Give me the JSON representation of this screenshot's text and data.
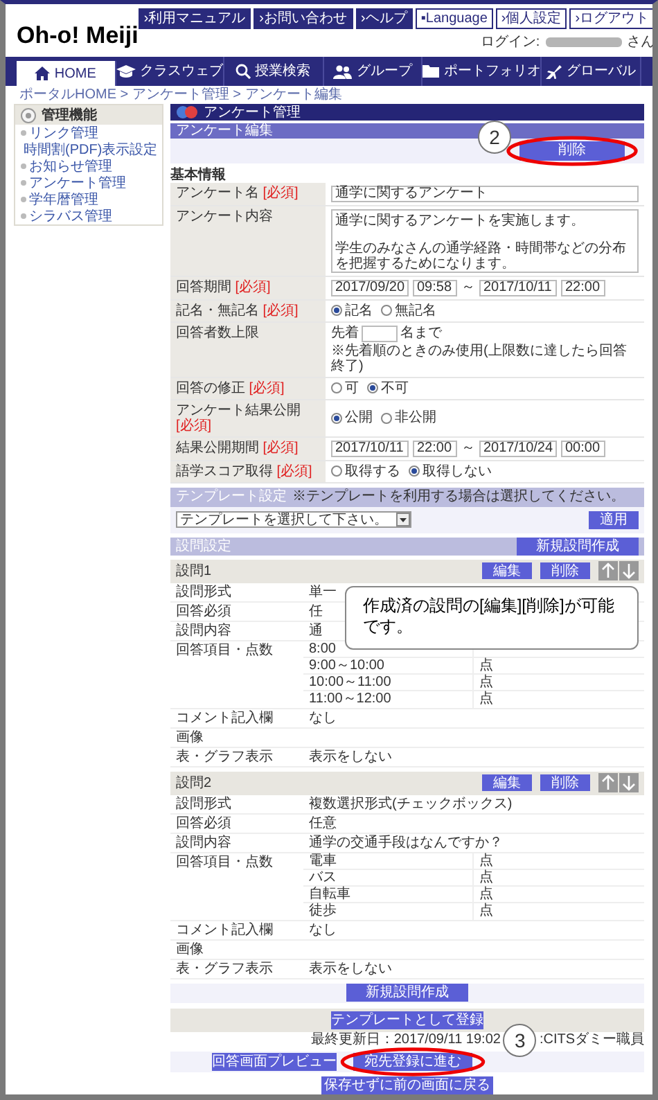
{
  "header": {
    "logo": "Oh-o! Meiji",
    "top_links": [
      {
        "label": "›利用マニュアル",
        "kind": "dark"
      },
      {
        "label": "›お問い合わせ",
        "kind": "dark"
      },
      {
        "label": "›ヘルプ",
        "kind": "dark"
      },
      {
        "label": "▪Language",
        "kind": "light"
      },
      {
        "label": "›個人設定",
        "kind": "light"
      },
      {
        "label": "›ログアウト",
        "kind": "light"
      }
    ],
    "login_label": "ログイン:",
    "login_suffix": "さん"
  },
  "nav": [
    {
      "label": "HOME",
      "selected": true
    },
    {
      "label": "クラスウェブ",
      "selected": false
    },
    {
      "label": "授業検索",
      "selected": false
    },
    {
      "label": "グループ",
      "selected": false
    },
    {
      "label": "ポートフォリオ",
      "selected": false
    },
    {
      "label": "グローバル",
      "selected": false
    }
  ],
  "breadcrumb": "ポータルHOME > アンケート管理 > アンケート編集",
  "sidebar": {
    "title": "管理機能",
    "items": [
      "リンク管理",
      "時間割(PDF)表示設定",
      "お知らせ管理",
      "アンケート管理",
      "学年暦管理",
      "シラバス管理"
    ]
  },
  "page_title": "アンケート管理",
  "section_title": "アンケート編集",
  "delete_button": "削除",
  "basic_info": {
    "heading": "基本情報",
    "rows": [
      {
        "kind": "text",
        "label": "アンケート名",
        "required": "[必須]",
        "value": "通学に関するアンケート"
      },
      {
        "kind": "textarea",
        "label": "アンケート内容",
        "lines": [
          "通学に関するアンケートを実施します。",
          "学生のみなさんの通学経路・時間帯などの分布を把握するためになります。"
        ]
      },
      {
        "kind": "period",
        "label": "回答期間",
        "required": "[必須]",
        "values": [
          "2017/09/20",
          "09:58",
          "2017/10/11",
          "22:00"
        ],
        "separator": "～"
      },
      {
        "kind": "radio",
        "label": "記名・無記名",
        "required": "[必須]",
        "options": [
          {
            "label": "記名",
            "selected": true
          },
          {
            "label": "無記名",
            "selected": false
          }
        ]
      },
      {
        "kind": "limit",
        "label": "回答者数上限",
        "prefix": "先着",
        "suffix": "名まで",
        "note": "※先着順のときのみ使用(上限数に達したら回答終了)"
      },
      {
        "kind": "radio",
        "label": "回答の修正",
        "required": "[必須]",
        "options": [
          {
            "label": "可",
            "selected": false
          },
          {
            "label": "不可",
            "selected": true
          }
        ]
      },
      {
        "kind": "radio",
        "label": "アンケート結果公開",
        "required": "[必須]",
        "options": [
          {
            "label": "公開",
            "selected": true
          },
          {
            "label": "非公開",
            "selected": false
          }
        ]
      },
      {
        "kind": "period",
        "label": "結果公開期間",
        "required": "[必須]",
        "values": [
          "2017/10/11",
          "22:00",
          "2017/10/24",
          "00:00"
        ],
        "separator": "～"
      },
      {
        "kind": "radio",
        "label": "語学スコア取得",
        "required": "[必須]",
        "options": [
          {
            "label": "取得する",
            "selected": false
          },
          {
            "label": "取得しない",
            "selected": true
          }
        ]
      }
    ]
  },
  "template": {
    "title": "テンプレート設定",
    "note": "※テンプレートを利用する場合は選択してください。",
    "select": "テンプレートを選択して下さい。",
    "apply": "適用"
  },
  "questions_section": {
    "title": "設問設定",
    "new_button": "新規設問作成"
  },
  "questions": [
    {
      "title": "設問1",
      "edit": "編集",
      "delete": "削除",
      "rows": [
        {
          "label": "設問形式",
          "value": "単一"
        },
        {
          "label": "回答必須",
          "value": "任"
        },
        {
          "label": "設問内容",
          "value": "通"
        },
        {
          "label": "回答項目・点数",
          "items": [
            {
              "choice": "8:00"
            },
            {
              "choice": "9:00～10:00",
              "points": "点"
            },
            {
              "choice": "10:00～11:00",
              "points": "点"
            },
            {
              "choice": "11:00～12:00",
              "points": "点"
            }
          ]
        },
        {
          "label": "コメント記入欄",
          "value": "なし"
        },
        {
          "label": "画像"
        },
        {
          "label": "表・グラフ表示",
          "value": "表示をしない"
        }
      ]
    },
    {
      "title": "設問2",
      "edit": "編集",
      "delete": "削除",
      "rows": [
        {
          "label": "設問形式",
          "value": "複数選択形式(チェックボックス)"
        },
        {
          "label": "回答必須",
          "value": "任意"
        },
        {
          "label": "設問内容",
          "value": "通学の交通手段はなんですか？"
        },
        {
          "label": "回答項目・点数",
          "items": [
            {
              "choice": "電車",
              "points": "点"
            },
            {
              "choice": "バス",
              "points": "点"
            },
            {
              "choice": "自転車",
              "points": "点"
            },
            {
              "choice": "徒歩",
              "points": "点"
            }
          ]
        },
        {
          "label": "コメント記入欄",
          "value": "なし"
        },
        {
          "label": "画像"
        },
        {
          "label": "表・グラフ表示",
          "value": "表示をしない"
        }
      ]
    }
  ],
  "tooltip": "作成済の設問の[編集][削除]が可能です。",
  "new_question_button": "新規設問作成",
  "register_template": "テンプレートとして登録",
  "last_updated": "最終更新日：2017/09/11 19:02",
  "updated_by": ":CITSダミー職員",
  "preview_button": "回答画面プレビュー",
  "proceed_button": "宛先登録に進む",
  "back_button": "保存せずに前の画面に戻る",
  "callouts": [
    {
      "number": "2"
    },
    {
      "number": "3"
    }
  ]
}
